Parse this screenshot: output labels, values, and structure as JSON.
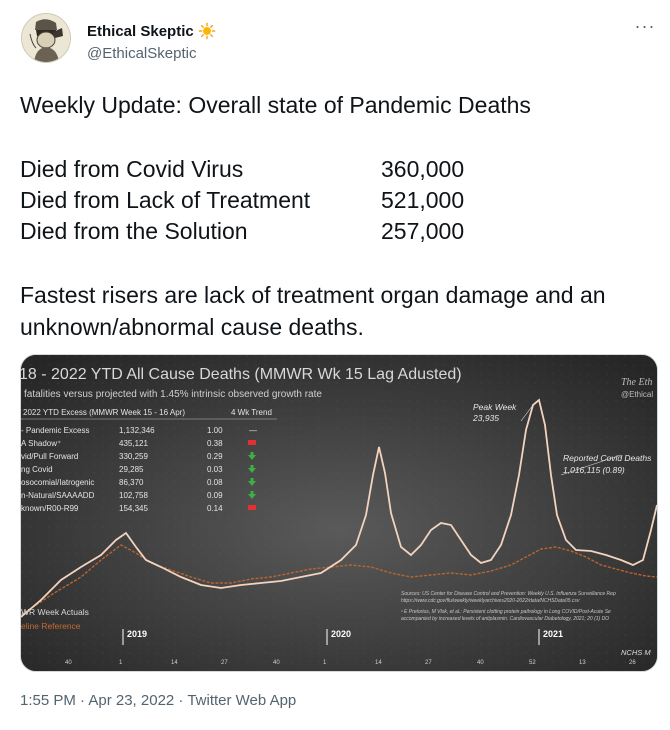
{
  "author": {
    "display_name": "Ethical Skeptic",
    "handle": "@EthicalSkeptic"
  },
  "tweet": {
    "headline": "Weekly Update: Overall state of Pandemic Deaths",
    "stats": [
      {
        "label": "Died from Covid Virus",
        "value": "360,000"
      },
      {
        "label": "Died from Lack of Treatment",
        "value": "521,000"
      },
      {
        "label": "Died from the Solution",
        "value": "257,000"
      }
    ],
    "risers_text": "Fastest risers are lack of treatment organ damage and an unknown/abnormal cause deaths.",
    "timestamp": "1:55 PM · Apr 23, 2022",
    "separator": " · ",
    "source_app": "Twitter Web App"
  },
  "media": {
    "title": "18 - 2022 YTD All Cause Deaths (MMWR Wk 15 Lag Adusted)",
    "subtitle": "l fatalities versus projected with 1.45% intrinsic observed growth rate",
    "watermark": "The Eth",
    "watermark_handle": "@Ethical",
    "table_header_left": "2022 YTD Excess (MMWR Week 15 - 16 Apr)",
    "table_header_right": "4 Wk Trend",
    "table_rows": [
      {
        "label": "- Pandemic Excess",
        "count": "1,132,346",
        "ratio": "1.00",
        "trend": "—"
      },
      {
        "label": "A Shadow⁺",
        "count": "435,121",
        "ratio": "0.38",
        "trend": "up-red"
      },
      {
        "label": "vid/Pull Forward",
        "count": "330,259",
        "ratio": "0.29",
        "trend": "down-green"
      },
      {
        "label": "ng Covid",
        "count": "29,285",
        "ratio": "0.03",
        "trend": "down-green"
      },
      {
        "label": "osocomial/Iatrogenic",
        "count": "86,370",
        "ratio": "0.08",
        "trend": "down-green"
      },
      {
        "label": "n-Natural/SAAAADD",
        "count": "102,758",
        "ratio": "0.09",
        "trend": "down-green"
      },
      {
        "label": "known/R00-R99",
        "count": "154,345",
        "ratio": "0.14",
        "trend": "up-red"
      }
    ],
    "peak_label": "Peak Week",
    "peak_value": "23,935",
    "reported_label": "Reported Covid Deaths",
    "reported_value": "1,016,115  (0.89)",
    "legend_actuals": "WR Week Actuals",
    "legend_baseline": "eline Reference",
    "years": [
      "2019",
      "2020",
      "2021"
    ],
    "week_ticks": [
      "40",
      "1",
      "14",
      "27",
      "40",
      "1",
      "14",
      "27",
      "40",
      "52",
      "13",
      "26"
    ],
    "sources_line1": "Sources: US Center for Disease Control and Prevention: Weekly U.S. Influenza Surveillance Rep",
    "sources_line2": "https://www.cdc.gov/flu/weekly/weeklyarchives2020-2022/data/NCHSData05.csv",
    "sources_line3": "¹ E Pretorius, M Vlok, et al.: Persistent clotting protein pathology in Long COVID/Post-Acute Se",
    "sources_line4": "accompanied by increased levels of antiplasmin. Cardiovascular Diabetology, 2021; 20 (1) DO",
    "nchs": "NCHS M",
    "colors": {
      "background": "#3a3a3a",
      "actual_line": "#f3d3bd",
      "baseline_line": "#b8652f",
      "red_trend": "#e03030",
      "green_trend": "#3cb043"
    }
  }
}
